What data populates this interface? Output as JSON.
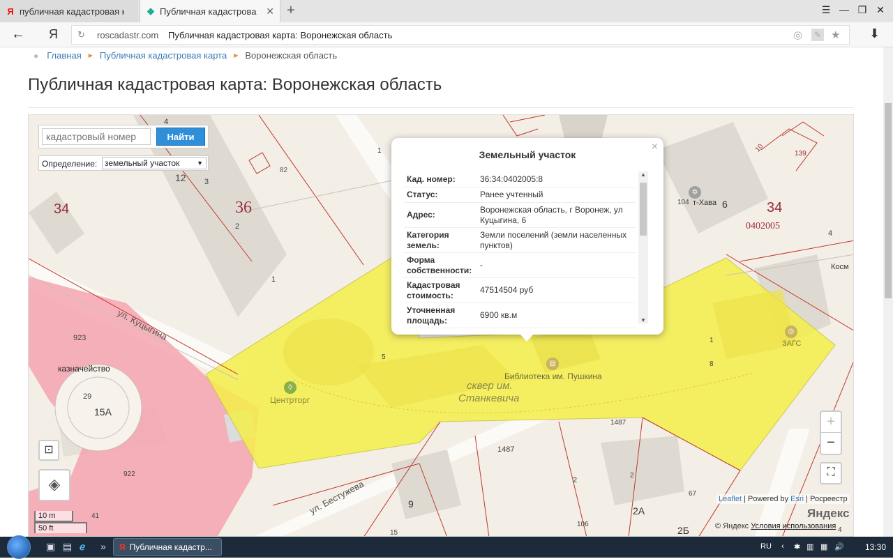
{
  "browser": {
    "tabs": [
      {
        "favicon": "yandex-icon",
        "favicon_text": "Я",
        "title": "публичная кадастровая карт"
      },
      {
        "favicon": "roscadastr-icon",
        "favicon_text": "◆",
        "title": "Публичная кадастрова"
      }
    ],
    "new_tab_symbol": "+",
    "window_controls": [
      "☰",
      "—",
      "❐",
      "✕"
    ],
    "back_symbol": "←",
    "yandex_button": "Я",
    "url_domain": "roscadastr.com",
    "url_page_title": "Публичная кадастровая карта: Воронежская область",
    "download_symbol": "⬇"
  },
  "breadcrumb": {
    "items": [
      "Главная",
      "Публичная кадастровая карта"
    ],
    "current": "Воронежская область"
  },
  "page_title": "Публичная кадастровая карта: Воронежская область",
  "search": {
    "placeholder": "кадастровый номер",
    "button_label": "Найти",
    "definition_label": "Определение:",
    "definition_value": "земельный участок"
  },
  "popup": {
    "title": "Земельный участок",
    "close_symbol": "×",
    "rows": [
      {
        "key": "Кад. номер:",
        "value": "36:34:0402005:8"
      },
      {
        "key": "Статус:",
        "value": "Ранее учтенный"
      },
      {
        "key": "Адрес:",
        "value": "Воронежская область, г Воронеж, ул Куцыгина, 6"
      },
      {
        "key": "Категория земель:",
        "value": "Земли поселений (земли населенных пунктов)"
      },
      {
        "key": "Форма собственности:",
        "value": "-"
      },
      {
        "key": "Кадастровая стоимость:",
        "value": "47514504 руб"
      },
      {
        "key": "Уточненная площадь:",
        "value": "6900 кв.м"
      }
    ]
  },
  "map_labels": {
    "n4": "4",
    "n1a": "1",
    "n82": "82",
    "n12": "12",
    "n3": "3",
    "n34a": "34",
    "n36": "36",
    "n2": "2",
    "n1b": "1",
    "street1": "ул. Куцыгина",
    "n923": "923",
    "kazn": "казначейство",
    "n29": "29",
    "n15a": "15А",
    "n922": "922",
    "n5": "5",
    "n6": "6",
    "centrtorg": "Центрторг",
    "library": "Библиотека им. Пушкина",
    "square1": "сквер им.",
    "square2": "Станкевича",
    "n1487a": "1487",
    "n1487b": "1487",
    "street2": "ул. Бестужева",
    "n9": "9",
    "n15": "15",
    "n2b": "2",
    "n2c": "2",
    "n2a": "2А",
    "n67": "67",
    "n106": "106",
    "n25": "2Б",
    "n10": "10",
    "n139": "139",
    "n104": "104",
    "khava": "т-Хава",
    "n6b": "6",
    "n34b": "34",
    "n0402005": "0402005",
    "n4b": "4",
    "kosm": "Косм",
    "n1c": "1",
    "n8": "8",
    "zags": "ЗАГС",
    "n41": "41",
    "n4c": "4"
  },
  "map_controls": {
    "zoom_in": "+",
    "zoom_out": "−",
    "fullscreen": "⛶",
    "ruler": "⊡",
    "layers": "◈"
  },
  "scale": {
    "metric": "10 m",
    "imperial": "50 ft"
  },
  "attribution": {
    "leaflet": "Leaflet",
    "powered": "Powered by",
    "esri": "Esri",
    "rosreestr": "Росреестр",
    "yandex_logo": "Яндекс",
    "copyright": "© Яндекс",
    "terms": "Условия использования"
  },
  "taskbar": {
    "task_label": "Публичная кадастр...",
    "task_favicon": "Я",
    "language": "RU",
    "time": "13:30",
    "quick_icons": [
      "▣",
      "▤",
      "ℯ",
      "»"
    ],
    "tray_icons": [
      "‹",
      "✱",
      "▥",
      "▦",
      "🔊"
    ]
  },
  "colors": {
    "parcel_fill": "#f5ef4a",
    "parcel_border": "#c8c23a",
    "boundary_red": "#c0392b",
    "pink_zone": "#f4a3b0",
    "link_blue": "#3a7ab6",
    "button_blue": "#2f8fd9"
  }
}
